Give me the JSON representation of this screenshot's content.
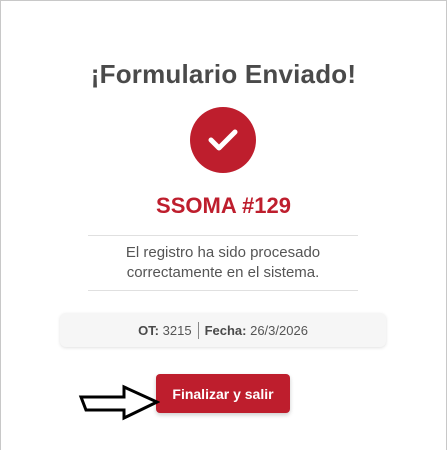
{
  "dialog": {
    "title": "¡Formulario Enviado!",
    "code": "SSOMA #129",
    "message": "El registro ha sido procesado correctamente en el sistema.",
    "ot_label": "OT:",
    "ot_value": "3215",
    "fecha_label": "Fecha:",
    "fecha_value": "26/3/2026",
    "finish_label": "Finalizar y salir"
  },
  "icons": {
    "status": "check-icon",
    "pointer": "arrow-right-icon"
  },
  "colors": {
    "accent": "#be1e2d",
    "title": "#4a4a4a",
    "text": "#555555"
  }
}
